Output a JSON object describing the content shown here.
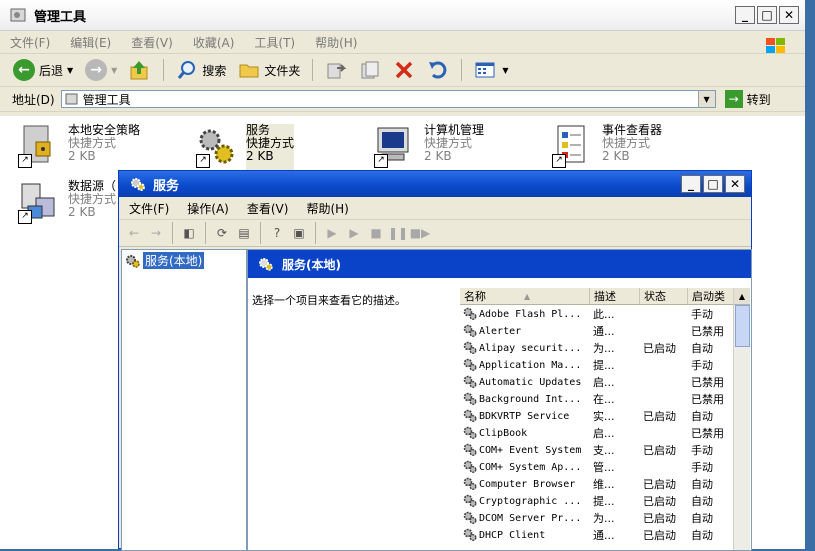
{
  "explorer": {
    "title": "管理工具",
    "menu": [
      "文件(F)",
      "编辑(E)",
      "查看(V)",
      "收藏(A)",
      "工具(T)",
      "帮助(H)"
    ],
    "toolbar": {
      "back": "后退",
      "search": "搜索",
      "folders": "文件夹"
    },
    "address": {
      "label": "地址(D)",
      "value": "管理工具",
      "go": "转到"
    },
    "items": [
      {
        "name": "本地安全策略",
        "type": "快捷方式",
        "size": "2 KB",
        "icon": "security-policy-icon"
      },
      {
        "name": "服务",
        "type": "快捷方式",
        "size": "2 KB",
        "icon": "services-gear-icon"
      },
      {
        "name": "计算机管理",
        "type": "快捷方式",
        "size": "2 KB",
        "icon": "computer-management-icon"
      },
      {
        "name": "事件查看器",
        "type": "快捷方式",
        "size": "2 KB",
        "icon": "event-viewer-icon"
      },
      {
        "name": "数据源（",
        "type": "快捷方式",
        "size": "2 KB",
        "icon": "data-source-icon"
      }
    ]
  },
  "services": {
    "title": "服务",
    "menu": [
      "文件(F)",
      "操作(A)",
      "查看(V)",
      "帮助(H)"
    ],
    "tree_item": "服务(本地)",
    "header": "服务(本地)",
    "description_prompt": "选择一个项目来查看它的描述。",
    "columns": [
      "名称",
      "描述",
      "状态",
      "启动类"
    ],
    "rows": [
      {
        "name": "Adobe Flash Pl...",
        "desc": "此...",
        "status": "",
        "startup": "手动"
      },
      {
        "name": "Alerter",
        "desc": "通...",
        "status": "",
        "startup": "已禁用"
      },
      {
        "name": "Alipay securit...",
        "desc": "为...",
        "status": "已启动",
        "startup": "自动"
      },
      {
        "name": "Application Ma...",
        "desc": "提...",
        "status": "",
        "startup": "手动"
      },
      {
        "name": "Automatic Updates",
        "desc": "启...",
        "status": "",
        "startup": "已禁用"
      },
      {
        "name": "Background Int...",
        "desc": "在...",
        "status": "",
        "startup": "已禁用"
      },
      {
        "name": "BDKVRTP Service",
        "desc": "实...",
        "status": "已启动",
        "startup": "自动"
      },
      {
        "name": "ClipBook",
        "desc": "启...",
        "status": "",
        "startup": "已禁用"
      },
      {
        "name": "COM+ Event System",
        "desc": "支...",
        "status": "已启动",
        "startup": "手动"
      },
      {
        "name": "COM+ System Ap...",
        "desc": "管...",
        "status": "",
        "startup": "手动"
      },
      {
        "name": "Computer Browser",
        "desc": "维...",
        "status": "已启动",
        "startup": "自动"
      },
      {
        "name": "Cryptographic ...",
        "desc": "提...",
        "status": "已启动",
        "startup": "自动"
      },
      {
        "name": "DCOM Server Pr...",
        "desc": "为...",
        "status": "已启动",
        "startup": "自动"
      },
      {
        "name": "DHCP Client",
        "desc": "通...",
        "status": "已启动",
        "startup": "自动"
      }
    ]
  }
}
